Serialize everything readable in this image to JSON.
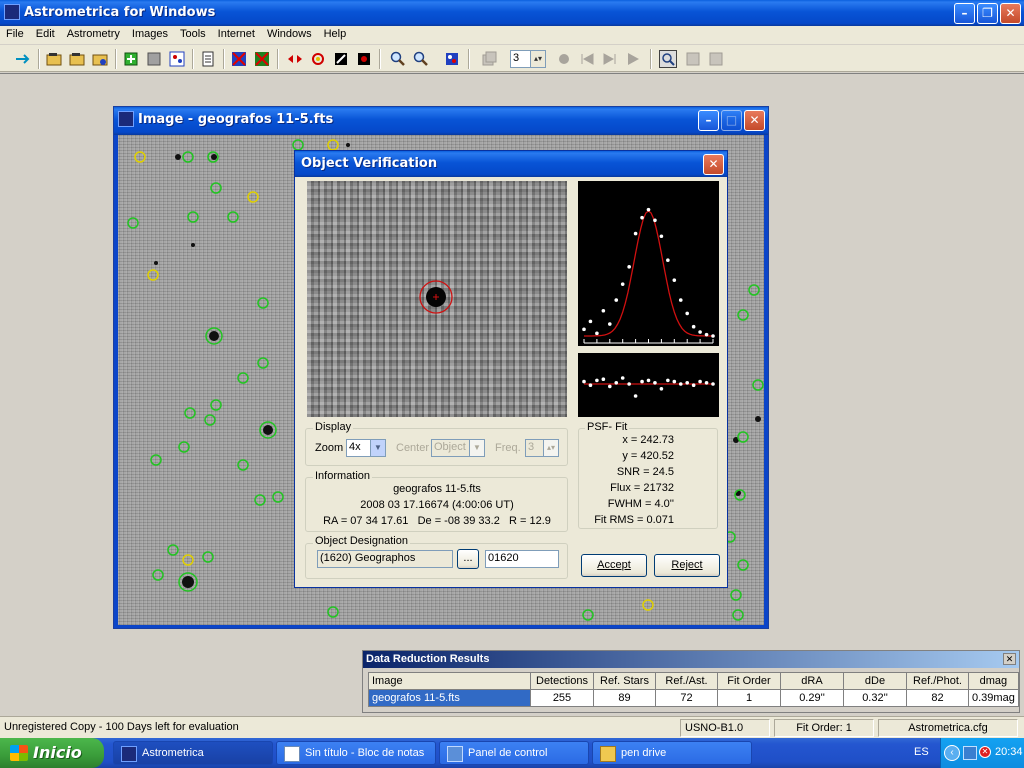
{
  "app": {
    "title": "Astrometrica for Windows",
    "menu": [
      "File",
      "Edit",
      "Astrometry",
      "Images",
      "Tools",
      "Internet",
      "Windows",
      "Help"
    ],
    "toolbar": {
      "frame_value": "3"
    }
  },
  "image_window": {
    "title": "Image - geografos 11-5.fts"
  },
  "verification": {
    "title": "Object Verification",
    "display": {
      "label": "Display",
      "zoom_label": "Zoom",
      "zoom_value": "4x",
      "center_label": "Center",
      "center_value": "Object",
      "freq_label": "Freq.",
      "freq_value": "3"
    },
    "info": {
      "label": "Information",
      "file": "geografos 11-5.fts",
      "date": "2008 03 17.16674 (4:00:06 UT)",
      "coords": "RA = 07 34 17.61   De = -08 39 33.2   R = 12.9"
    },
    "designation": {
      "label": "Object Designation",
      "name": "(1620) Geographos",
      "browse": "...",
      "code": "01620"
    },
    "psf": {
      "label": "PSF- Fit",
      "x": "x = 242.73",
      "y": "y = 420.52",
      "snr": "SNR = 24.5",
      "flux": "Flux = 21732",
      "fwhm": "FWHM = 4.0''",
      "rms": "Fit RMS = 0.071"
    },
    "accept": "Accept",
    "reject": "Reject"
  },
  "data_reduction": {
    "title": "Data Reduction Results",
    "headers": [
      "Image",
      "Detections",
      "Ref. Stars",
      "Ref./Ast.",
      "Fit Order",
      "dRA",
      "dDe",
      "Ref./Phot.",
      "dmag"
    ],
    "row": [
      "geografos 11-5.fts",
      "255",
      "89",
      "72",
      "1",
      "0.29''",
      "0.32''",
      "82",
      "0.39mag"
    ]
  },
  "statusbar": {
    "registration": "Unregistered Copy - 100 Days left for evaluation",
    "catalog": "USNO-B1.0",
    "fit_order": "Fit Order: 1",
    "config": "Astrometrica.cfg"
  },
  "taskbar": {
    "start": "Inicio",
    "tasks": [
      "Astrometrica",
      "Sin título - Bloc de notas",
      "Panel de control",
      "pen drive"
    ],
    "lang": "ES",
    "clock": "20:34"
  },
  "colors": {
    "title_blue": "#0854d6",
    "circle_green": "#22c422",
    "circle_yellow": "#e0d000",
    "fit_red": "#d01010"
  },
  "chart_data": [
    {
      "type": "scatter",
      "description_key": "psf-profile",
      "x": [
        0,
        5,
        10,
        15,
        20,
        25,
        30,
        35,
        40,
        45,
        50,
        55,
        60,
        65,
        70,
        75,
        80,
        85,
        90,
        95,
        100
      ],
      "y": [
        0.08,
        0.14,
        0.05,
        0.22,
        0.12,
        0.3,
        0.42,
        0.55,
        0.8,
        0.92,
        0.98,
        0.9,
        0.78,
        0.6,
        0.45,
        0.3,
        0.2,
        0.1,
        0.06,
        0.04,
        0.03
      ],
      "fit": "gaussian"
    },
    {
      "type": "scatter",
      "description_key": "psf-residuals",
      "x": [
        0,
        5,
        10,
        15,
        20,
        25,
        30,
        35,
        40,
        45,
        50,
        55,
        60,
        65,
        70,
        75,
        80,
        85,
        90,
        95,
        100
      ],
      "y": [
        0.02,
        -0.01,
        0.03,
        0.04,
        -0.02,
        0.01,
        0.05,
        0.0,
        -0.1,
        0.02,
        0.03,
        0.01,
        -0.04,
        0.03,
        0.02,
        0.0,
        0.01,
        -0.01,
        0.02,
        0.01,
        0.0
      ]
    }
  ]
}
